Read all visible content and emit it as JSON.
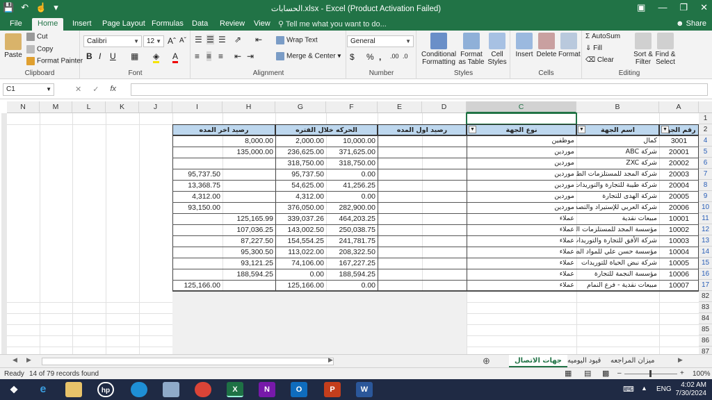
{
  "titlebar": {
    "title": "الحسابات.xlsx - Excel (Product Activation Failed)"
  },
  "tabs": [
    {
      "label": "File"
    },
    {
      "label": "Home"
    },
    {
      "label": "Insert"
    },
    {
      "label": "Page Layout"
    },
    {
      "label": "Formulas"
    },
    {
      "label": "Data"
    },
    {
      "label": "Review"
    },
    {
      "label": "View"
    }
  ],
  "tellme": "Tell me what you want to do...",
  "share": "Share",
  "ribbon": {
    "clipboard": {
      "paste": "Paste",
      "cut": "Cut",
      "copy": "Copy",
      "format_painter": "Format Painter",
      "name": "Clipboard"
    },
    "font": {
      "font_name": "Calibri",
      "font_size": "12",
      "name": "Font"
    },
    "alignment": {
      "wrap": "Wrap Text",
      "merge": "Merge & Center",
      "name": "Alignment"
    },
    "number": {
      "format": "General",
      "name": "Number"
    },
    "styles": {
      "cond": "Conditional Formatting",
      "table": "Format as Table",
      "cell": "Cell Styles",
      "name": "Styles"
    },
    "cells": {
      "insert": "Insert",
      "delete": "Delete",
      "format": "Format",
      "name": "Cells"
    },
    "editing": {
      "autosum": "AutoSum",
      "fill": "Fill",
      "clear": "Clear",
      "sort": "Sort & Filter",
      "find": "Find & Select",
      "name": "Editing"
    }
  },
  "formula": {
    "namebox": "C1",
    "content": ""
  },
  "columns": [
    "N",
    "M",
    "L",
    "K",
    "J",
    "I",
    "H",
    "G",
    "F",
    "E",
    "D",
    "C",
    "B",
    "A"
  ],
  "row_numbers": [
    "1",
    "2",
    "4",
    "5",
    "6",
    "7",
    "8",
    "9",
    "10",
    "11",
    "12",
    "13",
    "14",
    "15",
    "16",
    "17",
    "82",
    "83",
    "84",
    "85",
    "86",
    "87"
  ],
  "table": {
    "headers": {
      "A": "رقم الجهة",
      "B": "اسم الجهة",
      "C": "نوع الجهة",
      "DE": "رصيد اول المده",
      "FG": "الحركه خلال الفتره",
      "HI": "رصيد اخر المده"
    },
    "rows": [
      {
        "A": "3001",
        "B": "كمال",
        "C": "موظفين",
        "F": "10,000.00",
        "G": "2,000.00",
        "H": "8,000.00",
        "I": ""
      },
      {
        "A": "20001",
        "B": "شركة ABC",
        "C": "موردين",
        "F": "371,625.00",
        "G": "236,625.00",
        "H": "135,000.00",
        "I": ""
      },
      {
        "A": "20002",
        "B": "شركة ZXC",
        "C": "موردين",
        "F": "318,750.00",
        "G": "318,750.00",
        "H": "",
        "I": ""
      },
      {
        "A": "20003",
        "B": "شركة المجد للمستلزمات الطبية",
        "C": "موردين",
        "F": "0.00",
        "G": "95,737.50",
        "H": "",
        "I": "95,737.50"
      },
      {
        "A": "20004",
        "B": "شركة طيبة للتجارة والتوريدات",
        "C": "موردين",
        "F": "41,256.25",
        "G": "54,625.00",
        "H": "",
        "I": "13,368.75"
      },
      {
        "A": "20005",
        "B": "شركة الهدى للتجارة",
        "C": "موردين",
        "F": "0.00",
        "G": "4,312.00",
        "H": "",
        "I": "4,312.00"
      },
      {
        "A": "20006",
        "B": "شركة العربي للإستيراد والتصدير",
        "C": "موردين",
        "F": "282,900.00",
        "G": "376,050.00",
        "H": "",
        "I": "93,150.00"
      },
      {
        "A": "10001",
        "B": "مبيعات نقدية",
        "C": "عملاء",
        "F": "464,203.25",
        "G": "339,037.26",
        "H": "125,165.99",
        "I": ""
      },
      {
        "A": "10002",
        "B": "مؤسسة المجد للمستلزمات الطبية",
        "C": "عملاء",
        "F": "250,038.75",
        "G": "143,002.50",
        "H": "107,036.25",
        "I": ""
      },
      {
        "A": "10003",
        "B": "شركة الأفق للتجارة والتوريدات",
        "C": "عملاء",
        "F": "241,781.75",
        "G": "154,554.25",
        "H": "87,227.50",
        "I": ""
      },
      {
        "A": "10004",
        "B": "مؤسسة حسن علي للمواد الطبية",
        "C": "عملاء",
        "F": "208,322.50",
        "G": "113,022.00",
        "H": "95,300.50",
        "I": ""
      },
      {
        "A": "10005",
        "B": "شركة نبض الحياة للتوريدات",
        "C": "عملاء",
        "F": "167,227.25",
        "G": "74,106.00",
        "H": "93,121.25",
        "I": ""
      },
      {
        "A": "10006",
        "B": "مؤسسة النجمة للتجارة",
        "C": "عملاء",
        "F": "188,594.25",
        "G": "0.00",
        "H": "188,594.25",
        "I": ""
      },
      {
        "A": "10007",
        "B": "مبيعات نقدية - فرع النمام",
        "C": "عملاء",
        "F": "0.00",
        "G": "125,166.00",
        "H": "",
        "I": "125,166.00"
      }
    ],
    "extra_J17": "125,166.00"
  },
  "sheets": [
    {
      "label": "ميزان المراجعه"
    },
    {
      "label": "قيود اليوميه"
    },
    {
      "label": "جهات الاتصال"
    }
  ],
  "status": {
    "ready": "Ready",
    "records": "14 of 79 records found",
    "zoom": "100%"
  },
  "taskbar": {
    "lang": "ENG",
    "time": "4:02 AM",
    "date": "7/30/2024"
  },
  "colors": {
    "excel_green": "#217346",
    "header_fill": "#bdd7ee"
  }
}
